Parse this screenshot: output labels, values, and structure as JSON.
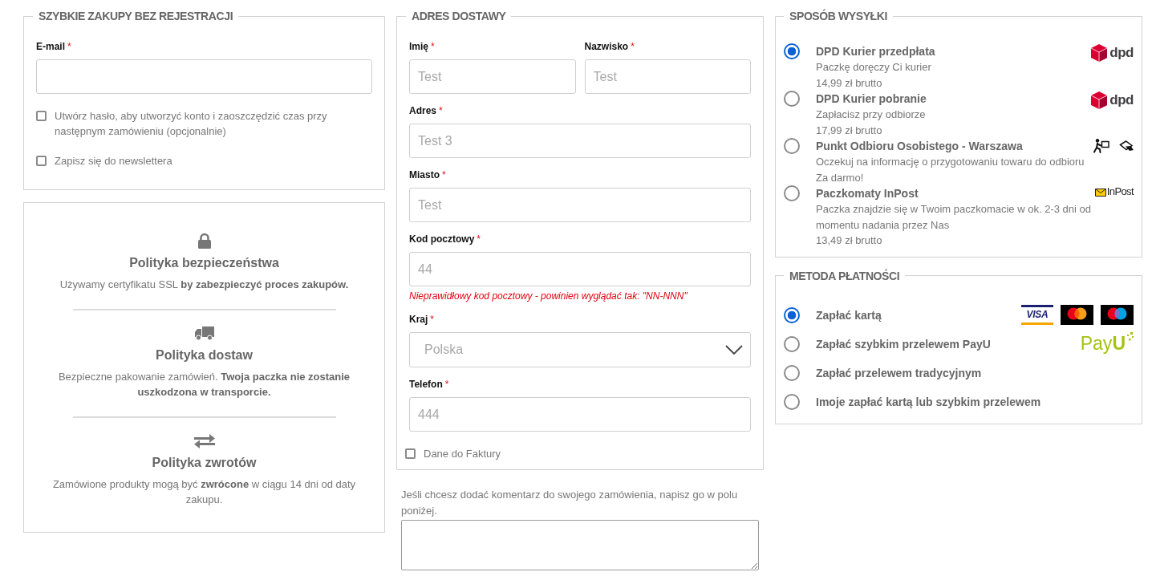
{
  "quick_checkout": {
    "title": "SZYBKIE ZAKUPY BEZ REJESTRACJI",
    "email": {
      "label": "E-mail",
      "required_mark": "*"
    },
    "options": [
      {
        "label": "Utwórz hasło, aby utworzyć konto i zaoszczędzić czas przy następnym zamówieniu (opcjonalnie)",
        "checked": false
      },
      {
        "label": "Zapisz się do newslettera",
        "checked": false
      }
    ]
  },
  "policies": [
    {
      "kind": "lock",
      "title": "Polityka bezpieczeństwa",
      "text": "Używamy certyfikatu SSL **by zabezpieczyć proces zakupów.**"
    },
    {
      "kind": "truck",
      "title": "Polityka dostaw",
      "text": "Bezpieczne pakowanie zamówień. **Twoja paczka nie zostanie uszkodzona w transporcie.**"
    },
    {
      "kind": "exchange",
      "title": "Polityka zwrotów",
      "text": "Zamówione produkty mogą być **zwrócone** w ciągu 14 dni od daty zakupu."
    }
  ],
  "delivery_address": {
    "title": "ADRES DOSTAWY",
    "rows": [
      [
        {
          "kind": "text",
          "label": "Imię",
          "required_mark": "*",
          "value": "Test"
        },
        {
          "kind": "text",
          "label": "Nazwisko",
          "required_mark": "*",
          "value": "Test"
        }
      ],
      [
        {
          "kind": "text",
          "label": "Adres",
          "required_mark": "*",
          "value": "Test 3"
        }
      ],
      [
        {
          "kind": "text",
          "label": "Miasto",
          "required_mark": "*",
          "value": "Test"
        }
      ],
      [
        {
          "kind": "text",
          "label": "Kod pocztowy",
          "required_mark": "*",
          "value": "44",
          "error": "Nieprawidłowy kod pocztowy - powinien wyglądać tak: \"NN-NNN\""
        }
      ],
      [
        {
          "kind": "select",
          "label": "Kraj",
          "required_mark": "*",
          "value": "Polska"
        }
      ],
      [
        {
          "kind": "text",
          "label": "Telefon",
          "required_mark": "*",
          "value": "444"
        }
      ]
    ],
    "invoice": {
      "label": "Dane do Faktury",
      "checked": false
    }
  },
  "comment": {
    "prompt": "Jeśli chcesz dodać komentarz do swojego zamówienia, napisz go w polu poniżej."
  },
  "shipping": {
    "title": "SPOSÓB WYSYŁKI",
    "options": [
      {
        "name": "DPD Kurier przedpłata",
        "details": [
          "Paczkę doręczy Ci kurier",
          "14,99 zł brutto"
        ],
        "selected": true,
        "logos": [
          {
            "kind": "dpd",
            "text": "dpd"
          }
        ]
      },
      {
        "name": "DPD Kurier pobranie",
        "details": [
          "Zapłacisz przy odbiorze",
          "17,99 zł brutto"
        ],
        "selected": false,
        "logos": [
          {
            "kind": "dpd",
            "text": "dpd"
          }
        ]
      },
      {
        "name": "Punkt Odbioru Osobistego - Warszawa",
        "details": [
          "Oczekuj na informację o przygotowaniu towaru do odbioru",
          "Za darmo!"
        ],
        "selected": false,
        "logos": [
          {
            "kind": "courier"
          },
          {
            "kind": "hand"
          }
        ]
      },
      {
        "name": "Paczkomaty InPost",
        "details": [
          "Paczka znajdzie się w Twoim paczkomacie w ok. 2-3 dni od momentu nadania przez Nas",
          "13,49 zł brutto"
        ],
        "selected": false,
        "logos": [
          {
            "kind": "inpost",
            "text": "InPost"
          }
        ]
      }
    ]
  },
  "payment": {
    "title": "METODA PŁATNOŚCI",
    "options": [
      {
        "name": "Zapłać kartą",
        "selected": true,
        "logos": [
          {
            "kind": "visa",
            "text": "VISA"
          },
          {
            "kind": "mastercard"
          },
          {
            "kind": "maestro"
          }
        ]
      },
      {
        "name": "Zapłać szybkim przelewem PayU",
        "selected": false,
        "logos": [
          {
            "kind": "payu",
            "text": "Pay**U**"
          }
        ]
      },
      {
        "name": "Zapłać przelewem tradycyjnym",
        "selected": false
      },
      {
        "name": "Imoje zapłać kartą lub szybkim przelewem",
        "selected": false
      }
    ]
  }
}
